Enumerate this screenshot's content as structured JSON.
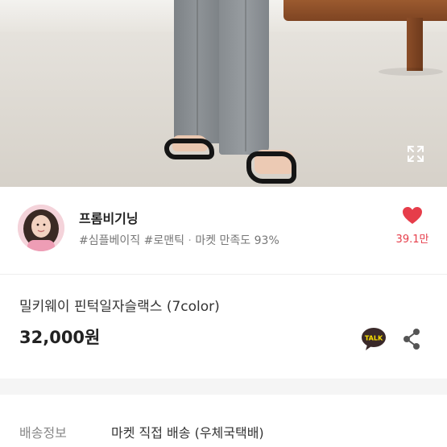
{
  "seller": {
    "name": "프롬비기닝",
    "tag1": "#심플베이직",
    "tag2": "#로맨틱",
    "separator": "·",
    "satisfaction": "마켓 만족도 93%",
    "likes": "39.1만"
  },
  "product": {
    "title": "밀키웨이 핀턱일자슬랙스 (7color)",
    "price": "32,000원"
  },
  "shipping": {
    "label": "배송정보",
    "value": "마켓 직접 배송 (우체국택배)"
  },
  "icons": {
    "expand": "expand-icon",
    "heart": "heart-icon",
    "kakao_talk": "kakaotalk-icon",
    "share": "share-icon"
  },
  "colors": {
    "accent": "#e63d4a",
    "price_text": "#222222",
    "tag_text": "#777777",
    "kakao_bubble": "#3a2929",
    "kakao_bg": "#fae100"
  }
}
